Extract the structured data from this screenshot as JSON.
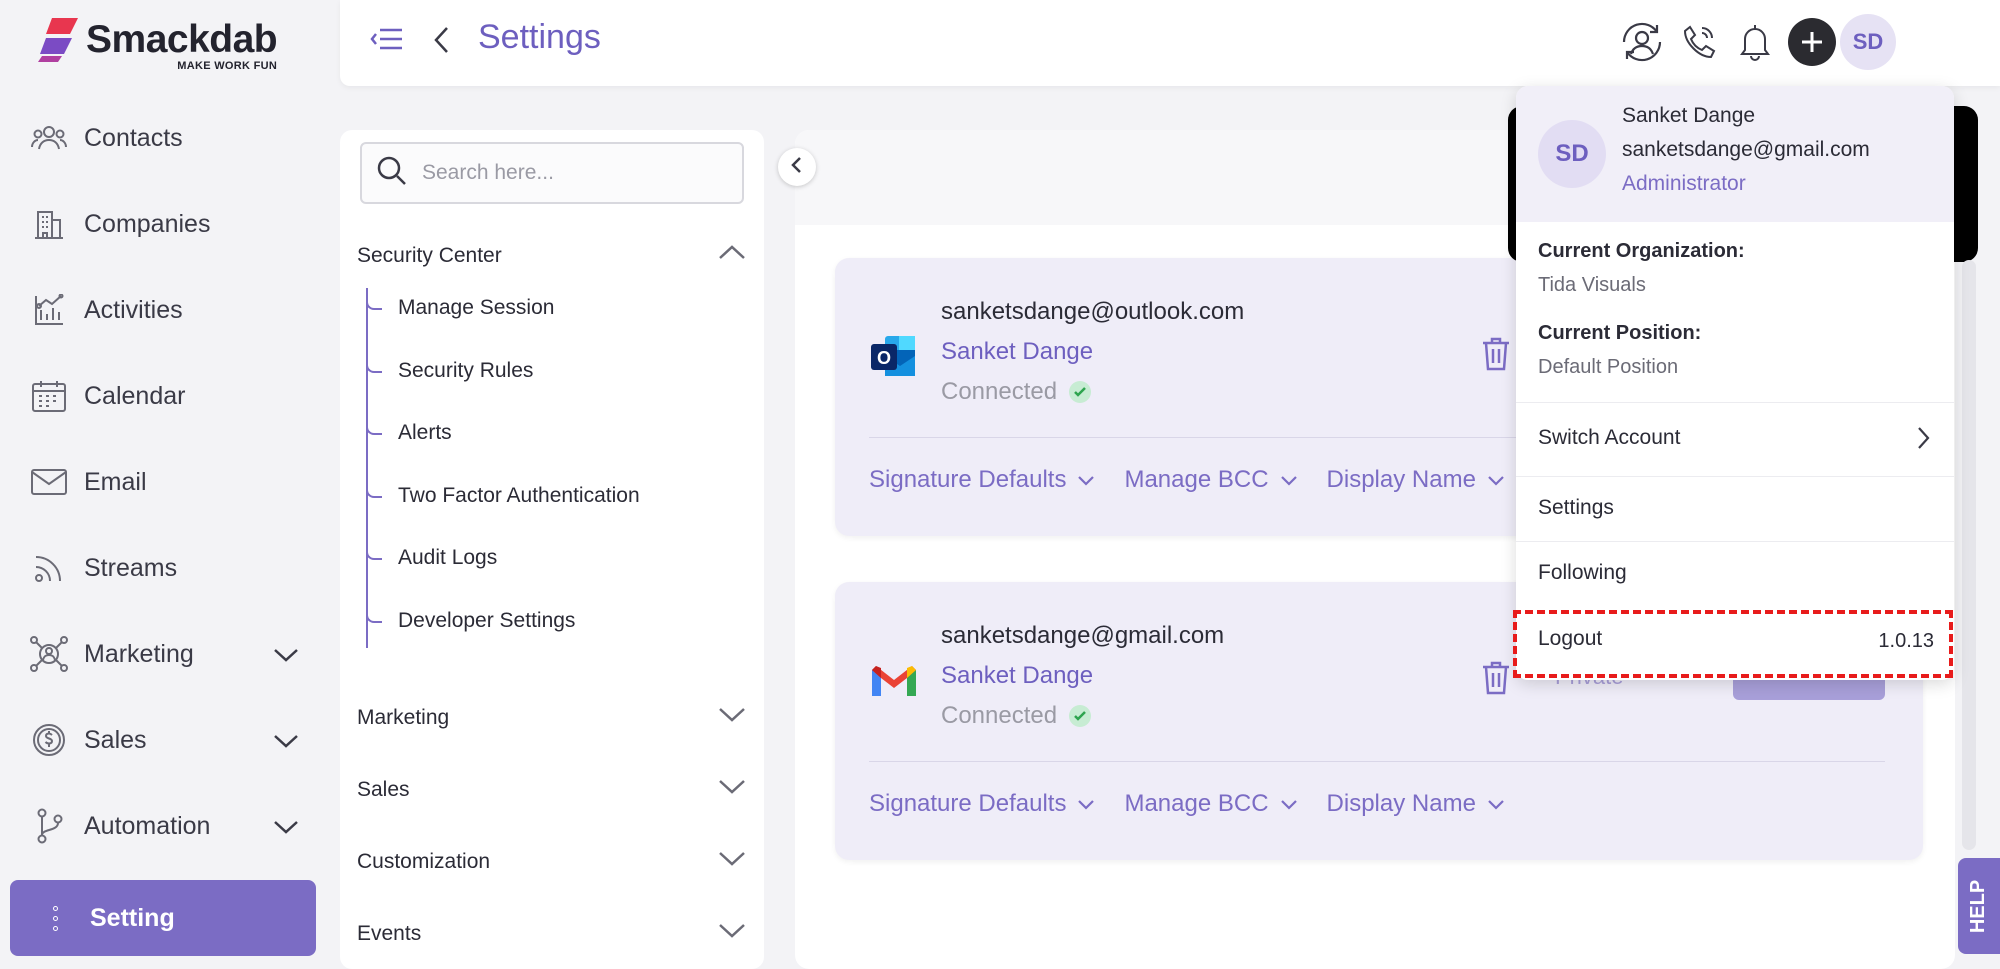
{
  "app": {
    "brand_name": "Smackdab",
    "brand_tagline": "MAKE WORK FUN",
    "page_title": "Settings",
    "accent_color": "#7b6cc4"
  },
  "sidebar": {
    "items": [
      {
        "label": "Contacts",
        "icon": "contacts-icon"
      },
      {
        "label": "Companies",
        "icon": "companies-icon"
      },
      {
        "label": "Activities",
        "icon": "activities-icon"
      },
      {
        "label": "Calendar",
        "icon": "calendar-icon"
      },
      {
        "label": "Email",
        "icon": "email-icon"
      },
      {
        "label": "Streams",
        "icon": "streams-icon"
      },
      {
        "label": "Marketing",
        "icon": "marketing-icon",
        "expandable": true
      },
      {
        "label": "Sales",
        "icon": "sales-icon",
        "expandable": true
      },
      {
        "label": "Automation",
        "icon": "automation-icon",
        "expandable": true
      }
    ],
    "active_item": {
      "label": "Setting",
      "icon": "more-vertical-icon"
    }
  },
  "topbar": {
    "avatar_initials": "SD",
    "icons": [
      "menu-collapse-icon",
      "back-icon",
      "user-sync-icon",
      "phone-icon",
      "bell-icon",
      "plus-icon"
    ]
  },
  "settings_nav": {
    "search_placeholder": "Search here...",
    "security_center": {
      "label": "Security Center",
      "expanded": true,
      "children": [
        "Manage Session",
        "Security Rules",
        "Alerts",
        "Two Factor Authentication",
        "Audit Logs",
        "Developer Settings"
      ]
    },
    "sections": [
      "Marketing",
      "Sales",
      "Customization",
      "Events"
    ]
  },
  "accounts": [
    {
      "provider": "outlook",
      "email": "sanketsdange@outlook.com",
      "name": "Sanket Dange",
      "status": "Connected",
      "options": [
        "Signature Defaults",
        "Manage BCC",
        "Display Name"
      ]
    },
    {
      "provider": "gmail",
      "email": "sanketsdange@gmail.com",
      "name": "Sanket Dange",
      "status": "Connected",
      "options": [
        "Signature Defaults",
        "Manage BCC",
        "Display Name"
      ],
      "visibility": "Private"
    }
  ],
  "profile_menu": {
    "initials": "SD",
    "name": "Sanket Dange",
    "email": "sanketsdange@gmail.com",
    "role": "Administrator",
    "org_label": "Current Organization:",
    "org_value": "Tida Visuals",
    "position_label": "Current Position:",
    "position_value": "Default Position",
    "switch_account": "Switch Account",
    "settings": "Settings",
    "following": "Following",
    "logout": "Logout",
    "version": "1.0.13"
  },
  "help_label": "HELP"
}
